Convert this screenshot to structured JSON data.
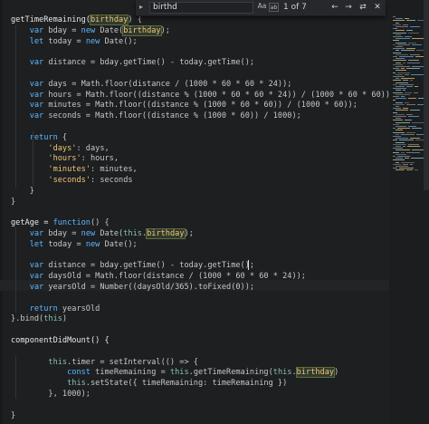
{
  "find_bar": {
    "query": "birthd",
    "option_case": "Aa",
    "option_word": "ab",
    "option_regex": ".*",
    "match_count": "1 of 7",
    "prev_label": "←",
    "next_label": "→",
    "select_all_label": "⇄",
    "close_label": "✕"
  },
  "colors": {
    "background": "#1d1f21",
    "keyword": "#5fb8ff",
    "string": "#f0c674",
    "plain": "#c5c8c6",
    "this": "#8abeb7"
  },
  "code_lines": [
    [
      [
        "getTimeRemaining(",
        "fn"
      ],
      [
        "birthday",
        "hl"
      ],
      [
        ") {",
        "p"
      ]
    ],
    [
      [
        "    ",
        "p"
      ],
      [
        "var",
        "kw"
      ],
      [
        " bday = ",
        "p"
      ],
      [
        "new",
        "kw"
      ],
      [
        " Date(",
        "p"
      ],
      [
        "birthday",
        "hl"
      ],
      [
        ");",
        "p"
      ]
    ],
    [
      [
        "    ",
        "p"
      ],
      [
        "let",
        "kw"
      ],
      [
        " today = ",
        "p"
      ],
      [
        "new",
        "kw"
      ],
      [
        " Date();",
        "p"
      ]
    ],
    [
      [
        "",
        "p"
      ]
    ],
    [
      [
        "    ",
        "p"
      ],
      [
        "var",
        "kw"
      ],
      [
        " distance = bday.getTime() - today.getTime();",
        "p"
      ]
    ],
    [
      [
        "",
        "p"
      ]
    ],
    [
      [
        "    ",
        "p"
      ],
      [
        "var",
        "kw"
      ],
      [
        " days = Math.floor(distance / (1000 * 60 * 60 * 24));",
        "p"
      ]
    ],
    [
      [
        "    ",
        "p"
      ],
      [
        "var",
        "kw"
      ],
      [
        " hours = Math.floor((distance % (1000 * 60 * 60 * 24)) / (1000 * 60 * 60));",
        "p"
      ]
    ],
    [
      [
        "    ",
        "p"
      ],
      [
        "var",
        "kw"
      ],
      [
        " minutes = Math.floor((distance % (1000 * 60 * 60)) / (1000 * 60));",
        "p"
      ]
    ],
    [
      [
        "    ",
        "p"
      ],
      [
        "var",
        "kw"
      ],
      [
        " seconds = Math.floor((distance % (1000 * 60)) / 1000);",
        "p"
      ]
    ],
    [
      [
        "",
        "p"
      ]
    ],
    [
      [
        "    ",
        "p"
      ],
      [
        "return",
        "kw"
      ],
      [
        " {",
        "p"
      ]
    ],
    [
      [
        "        ",
        "p"
      ],
      [
        "'days'",
        "str"
      ],
      [
        ": days,",
        "p"
      ]
    ],
    [
      [
        "        ",
        "p"
      ],
      [
        "'hours'",
        "str"
      ],
      [
        ": hours,",
        "p"
      ]
    ],
    [
      [
        "        ",
        "p"
      ],
      [
        "'minutes'",
        "str"
      ],
      [
        ": minutes,",
        "p"
      ]
    ],
    [
      [
        "        ",
        "p"
      ],
      [
        "'seconds'",
        "str"
      ],
      [
        ": seconds",
        "p"
      ]
    ],
    [
      [
        "    }",
        "p"
      ]
    ],
    [
      [
        "}",
        "p"
      ]
    ],
    [
      [
        "",
        "p"
      ]
    ],
    [
      [
        "getAge = ",
        "fn"
      ],
      [
        "function",
        "kw"
      ],
      [
        "() {",
        "p"
      ]
    ],
    [
      [
        "    ",
        "p"
      ],
      [
        "var",
        "kw"
      ],
      [
        " bday = ",
        "p"
      ],
      [
        "new",
        "kw"
      ],
      [
        " Date(",
        "p"
      ],
      [
        "this",
        "this"
      ],
      [
        ".",
        "p"
      ],
      [
        "birthday",
        "hl"
      ],
      [
        ");",
        "p"
      ]
    ],
    [
      [
        "    ",
        "p"
      ],
      [
        "let",
        "kw"
      ],
      [
        " today = ",
        "p"
      ],
      [
        "new",
        "kw"
      ],
      [
        " Date();",
        "p"
      ]
    ],
    [
      [
        "",
        "p"
      ]
    ],
    [
      [
        "    ",
        "p"
      ],
      [
        "var",
        "kw"
      ],
      [
        " distance = bday.getTime() - today.getTime();",
        "p"
      ]
    ],
    [
      [
        "    ",
        "p"
      ],
      [
        "var",
        "kw"
      ],
      [
        " daysOld = Math.floor(distance / (1000 * 60 * 60 * 24));",
        "p"
      ]
    ],
    [
      [
        "    ",
        "p"
      ],
      [
        "var",
        "kw"
      ],
      [
        " yearsOld = Number((daysOld/365).toFixed(0));",
        "p"
      ]
    ],
    [
      [
        "",
        "p"
      ]
    ],
    [
      [
        "    ",
        "p"
      ],
      [
        "return",
        "kw"
      ],
      [
        " yearsOld",
        "p"
      ]
    ],
    [
      [
        "}.bind(",
        "p"
      ],
      [
        "this",
        "this"
      ],
      [
        ")",
        "p"
      ]
    ],
    [
      [
        "",
        "p"
      ]
    ],
    [
      [
        "componentDidMount() {",
        "fn"
      ]
    ],
    [
      [
        "",
        "p"
      ]
    ],
    [
      [
        "        ",
        "p"
      ],
      [
        "this",
        "this"
      ],
      [
        ".timer = setInterval(() => {",
        "p"
      ]
    ],
    [
      [
        "            ",
        "p"
      ],
      [
        "const",
        "kw"
      ],
      [
        " timeRemaining = ",
        "p"
      ],
      [
        "this",
        "this"
      ],
      [
        ".getTimeRemaining(",
        "p"
      ],
      [
        "this",
        "this"
      ],
      [
        ".",
        "p"
      ],
      [
        "birthday",
        "hl"
      ],
      [
        ")",
        "p"
      ]
    ],
    [
      [
        "            ",
        "p"
      ],
      [
        "this",
        "this"
      ],
      [
        ".setState({ timeRemaining: timeRemaining })",
        "p"
      ]
    ],
    [
      [
        "        }, 1000);",
        "p"
      ]
    ],
    [
      [
        "",
        "p"
      ]
    ],
    [
      [
        "}",
        "p"
      ]
    ]
  ]
}
